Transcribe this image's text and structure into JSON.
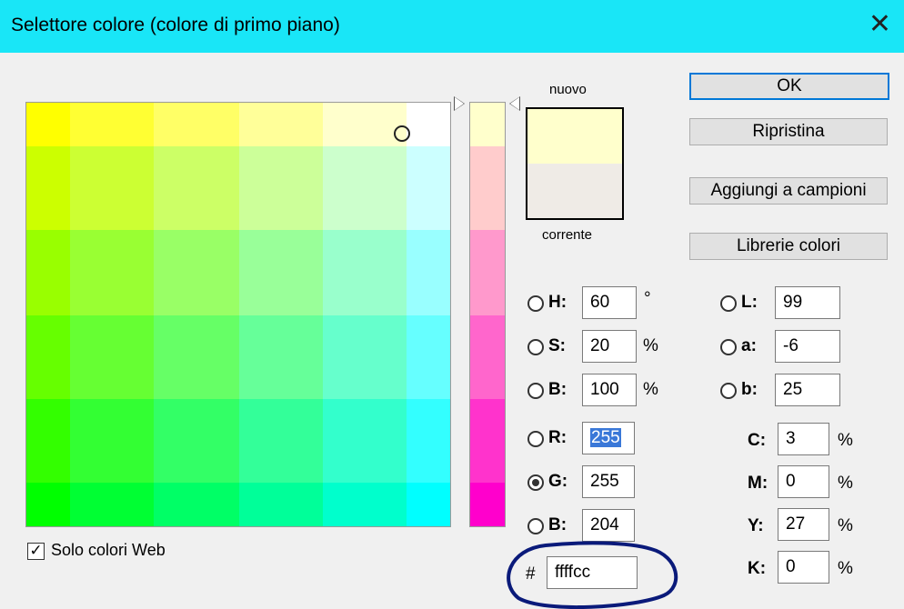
{
  "window": {
    "title": "Selettore colore (colore di primo piano)",
    "close_glyph": "✕"
  },
  "swatch": {
    "new_label": "nuovo",
    "current_label": "corrente",
    "new_color": "#ffffcc",
    "current_color": "#efebe6"
  },
  "buttons": {
    "ok": "OK",
    "reset": "Ripristina",
    "add_swatches": "Aggiungi a campioni",
    "libraries": "Librerie colori"
  },
  "hsb": [
    {
      "label": "H:",
      "value": "60",
      "unit": "°"
    },
    {
      "label": "S:",
      "value": "20",
      "unit": "%"
    },
    {
      "label": "B:",
      "value": "100",
      "unit": "%"
    }
  ],
  "rgb": [
    {
      "label": "R:",
      "value": "255"
    },
    {
      "label": "G:",
      "value": "255"
    },
    {
      "label": "B:",
      "value": "204"
    }
  ],
  "lab": [
    {
      "label": "L:",
      "value": "99"
    },
    {
      "label": "a:",
      "value": "-6"
    },
    {
      "label": "b:",
      "value": "25"
    }
  ],
  "cmyk": [
    {
      "label": "C:",
      "value": "3",
      "unit": "%"
    },
    {
      "label": "M:",
      "value": "0",
      "unit": "%"
    },
    {
      "label": "Y:",
      "value": "27",
      "unit": "%"
    },
    {
      "label": "K:",
      "value": "0",
      "unit": "%"
    }
  ],
  "hex": {
    "label": "#",
    "value": "ffffcc"
  },
  "web_only": {
    "label": "Solo colori Web",
    "checked": true
  },
  "colors": {
    "titlebar": "#19e6f7",
    "field_grid": [
      [
        "#ffff00",
        "#ffff33",
        "#ffff66",
        "#ffff99",
        "#ffffcc",
        "#ffffff"
      ],
      [
        "#ccff00",
        "#ccff33",
        "#ccff66",
        "#ccff99",
        "#ccffcc",
        "#ccffff"
      ],
      [
        "#99ff00",
        "#99ff33",
        "#99ff66",
        "#99ff99",
        "#99ffcc",
        "#99ffff"
      ],
      [
        "#66ff00",
        "#66ff33",
        "#66ff66",
        "#66ff99",
        "#66ffcc",
        "#66ffff"
      ],
      [
        "#33ff00",
        "#33ff33",
        "#33ff66",
        "#33ff99",
        "#33ffcc",
        "#33ffff"
      ],
      [
        "#00ff00",
        "#00ff33",
        "#00ff66",
        "#00ff99",
        "#00ffcc",
        "#00ffff"
      ]
    ],
    "slider": [
      "#ffffcc",
      "#ffcccc",
      "#ff99cc",
      "#ff66cc",
      "#ff33cc",
      "#ff00cc"
    ],
    "annotation": "#0a1a7a"
  }
}
